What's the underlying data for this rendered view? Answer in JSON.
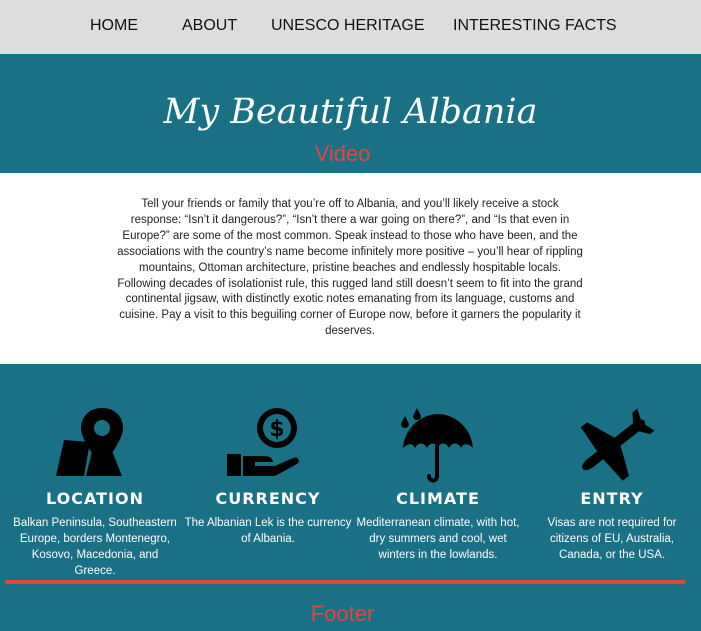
{
  "nav": {
    "items": [
      "HOME",
      "ABOUT",
      "UNESCO HERITAGE",
      "INTERESTING FACTS"
    ]
  },
  "hero": {
    "title": "My Beautiful Albania",
    "video_label": "Video"
  },
  "intro": {
    "text": "Tell your friends or family that you’re off to Albania, and you’ll likely receive a stock response: “Isn’t it dangerous?”, “Isn’t there a war going on there?”, and “Is that even in Europe?” are some of the most common. Speak instead to those who have been, and the associations with the country’s name become infinitely more positive – you’ll hear of rippling mountains, Ottoman architecture, pristine beaches and endlessly hospitable locals. Following decades of isolationist rule, this rugged land still doesn’t seem to fit into the grand continental jigsaw, with distinctly exotic notes emanating from its language, customs and cuisine. Pay a visit to this beguiling corner of Europe now, before it garners the popularity it deserves."
  },
  "features": [
    {
      "icon": "map-pin-icon",
      "title": "LOCATION",
      "text": "Balkan Peninsula, Southeastern Europe, borders Montenegro, Kosovo, Macedonia, and Greece."
    },
    {
      "icon": "currency-hand-icon",
      "title": "CURRENCY",
      "text": "The Albanian Lek is the currency of Albania."
    },
    {
      "icon": "umbrella-rain-icon",
      "title": "CLIMATE",
      "text": "Mediterranean climate, with hot, dry summers and cool, wet winters in the lowlands."
    },
    {
      "icon": "airplane-icon",
      "title": "ENTRY",
      "text": "Visas are not required for citizens of EU, Australia, Canada, or the USA."
    }
  ],
  "footer": {
    "label": "Footer"
  },
  "colors": {
    "teal": "#1a7185",
    "accent": "#e0483e",
    "nav_bg": "#dddddd"
  }
}
